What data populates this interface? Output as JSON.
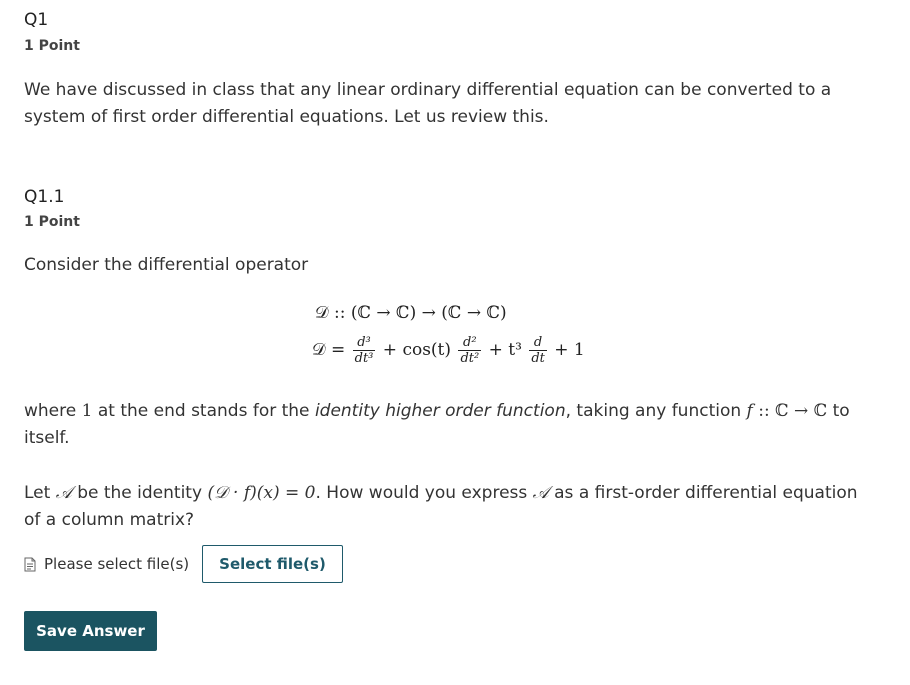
{
  "q1": {
    "title": "Q1",
    "points": "1 Point",
    "intro": "We have discussed in class that any linear ordinary differential equation can be converted to a system of first order differential equations. Let us review this."
  },
  "q1_1": {
    "title": "Q1.1",
    "points": "1 Point",
    "consider": "Consider the differential operator",
    "operator_type": "𝒟 :: (ℂ → ℂ) → (ℂ → ℂ)",
    "operator_def": {
      "lhs": "𝒟 =",
      "t1_num": "d³",
      "t1_den": "dt³",
      "plus_cos": "+ cos(t)",
      "t2_num": "d²",
      "t2_den": "dt²",
      "plus_t3": "+ t³",
      "t3_num": "d",
      "t3_den": "dt",
      "plus_one": "+ 1"
    },
    "where_text": {
      "a": "where ",
      "one": "1",
      "b": " at the end stands for the ",
      "em": "identity higher order function",
      "c": ", taking any function ",
      "f": "f",
      "sig": " :: ℂ → ℂ",
      "d": " to itself."
    },
    "question": {
      "a": "Let ",
      "A1": "𝒜",
      "b": " be the identity ",
      "expr": "(𝒟 · f)(x) = 0",
      "c": ". How would you express ",
      "A2": "𝒜",
      "d": " as a first-order differential equation of a column matrix?"
    },
    "file_label": "Please select file(s)",
    "select_button": "Select file(s)"
  },
  "save_button": "Save Answer",
  "colors": {
    "accent": "#1b5461",
    "text": "#333333"
  },
  "icons": {
    "file": "document-icon"
  }
}
